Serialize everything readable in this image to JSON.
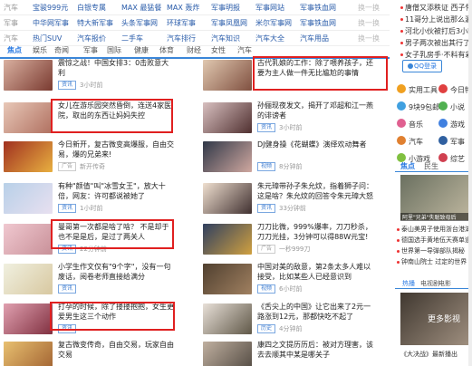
{
  "link_rows": [
    {
      "cat": "汽车",
      "links": [
        "宝骏999元",
        "白银专属",
        "MAX 最猛餐",
        "MAX 轰炸",
        "军事明报",
        "军事网站",
        "军事铁血网"
      ],
      "more": "换一换"
    },
    {
      "cat": "军事",
      "links": [
        "中华网军事",
        "特大新军事",
        "头条军事网",
        "环球军事",
        "军事凤凰网",
        "米尔军事网",
        "军事铁血网"
      ],
      "more": "换一换"
    },
    {
      "cat": "汽车",
      "links": [
        "热门SUV",
        "汽车报价",
        "二手车",
        "汽车排行",
        "汽车知识",
        "汽车大全",
        "汽车用品"
      ],
      "more": "换一换"
    }
  ],
  "tabs": [
    "焦点",
    "娱乐",
    "奇闻",
    "军事",
    "国际",
    "健康",
    "体育",
    "财经",
    "女性",
    "汽车"
  ],
  "left_news": [
    {
      "title": "震惊之战！中国女排3：0击败意大利",
      "tag": "资讯",
      "meta": "3小时前"
    },
    {
      "title": "女儿在游乐园突然昏倒，连送4家医院，取出的东西让妈妈失控",
      "tag": "",
      "meta": ""
    },
    {
      "title": "今日新开，复古微变高爆服，自由交易，爆的兄弟来!",
      "tag": "广告",
      "meta": "新开传奇"
    },
    {
      "title": "有种\"颜值\"叫\"冰雪女王\"，放大十倍，网友：许可都说被她了",
      "tag": "资讯",
      "meta": "1小时前"
    },
    {
      "title": "曼哥第一次都是啥了啥？ 不是却于也不是是后，是过了两关人",
      "tag": "资讯",
      "meta": "22分钟前"
    },
    {
      "title": "小学生作文仅有\"9个字\"，没有一句废话，阅卷老师直接给满分",
      "tag": "资讯",
      "meta": ""
    },
    {
      "title": "打孕的时候，除了搂搂抱抱，女生更爱男生这三个动作",
      "tag": "资讯",
      "meta": ""
    },
    {
      "title": "复古微变传奇，自由交易，玩家自由交易",
      "tag": "",
      "meta": ""
    }
  ],
  "mid_news": [
    {
      "title": "古代乳娘的工作：除了喂养孩子，还要为主人做一件无比尴尬的事情",
      "tag": "",
      "meta": ""
    },
    {
      "title": "孙俪现夜发文，揭开了邓超和江一燕的诽谤者",
      "tag": "资讯",
      "meta": "3小时前"
    },
    {
      "title": "DJ健身操《花蝴蝶》演绎欢动舞者",
      "tag": "视频",
      "meta": "8分钟前"
    },
    {
      "title": "朱元璋带孙子朱允炆，指着狮子问：这是啥？朱允炆的回答令朱元璋大怒",
      "tag": "资讯",
      "meta": "33分钟前"
    },
    {
      "title": "刀刀比微，999%爆率，刀刀秒杀，刀刀光挂，3分钟可以得88W元宝!",
      "tag": "广告",
      "meta": "一秒999刀"
    },
    {
      "title": "中国对美的敌意，第2条太多人难以接受，比如某些人已经意识到",
      "tag": "视频",
      "meta": "6小时前"
    },
    {
      "title": "《舌尖上的中国》让它出来了2元一路涨到12元，那都快吃不起了",
      "tag": "历史",
      "meta": "4分钟前"
    },
    {
      "title": "康四之文提历历后：被对方理害，该去去顺其中某是哪关子",
      "tag": "",
      "meta": ""
    }
  ],
  "right": {
    "top": [
      "唐僧又添秩证 西子怀孕",
      "11哥分上说出那么漏么？",
      "河北小伙被打后3小时",
      "男子两次被出其行了解",
      "女子乳房手·不料有彩墙"
    ],
    "qq": "QQ登录",
    "modules": [
      "实用工具",
      "今日特价",
      "9块9包邮",
      "小说",
      "音乐",
      "游戏",
      "汽车",
      "军事",
      "小游戏",
      "综艺"
    ],
    "tabs": [
      "焦点",
      "民生"
    ],
    "headline": "阿里\"兄弟\"失聪致母后",
    "news": [
      "泰山美男子使用浙台港湖地",
      "德国选手黄地伍天赛单道",
      "世界第一导弹部队揭秘",
      "钟南山院士 过定的世界"
    ],
    "tabs2": [
      "热播",
      "电视剧",
      "电影"
    ],
    "more_video": "更多影视",
    "video_caption": "《大决战》最新播出"
  }
}
